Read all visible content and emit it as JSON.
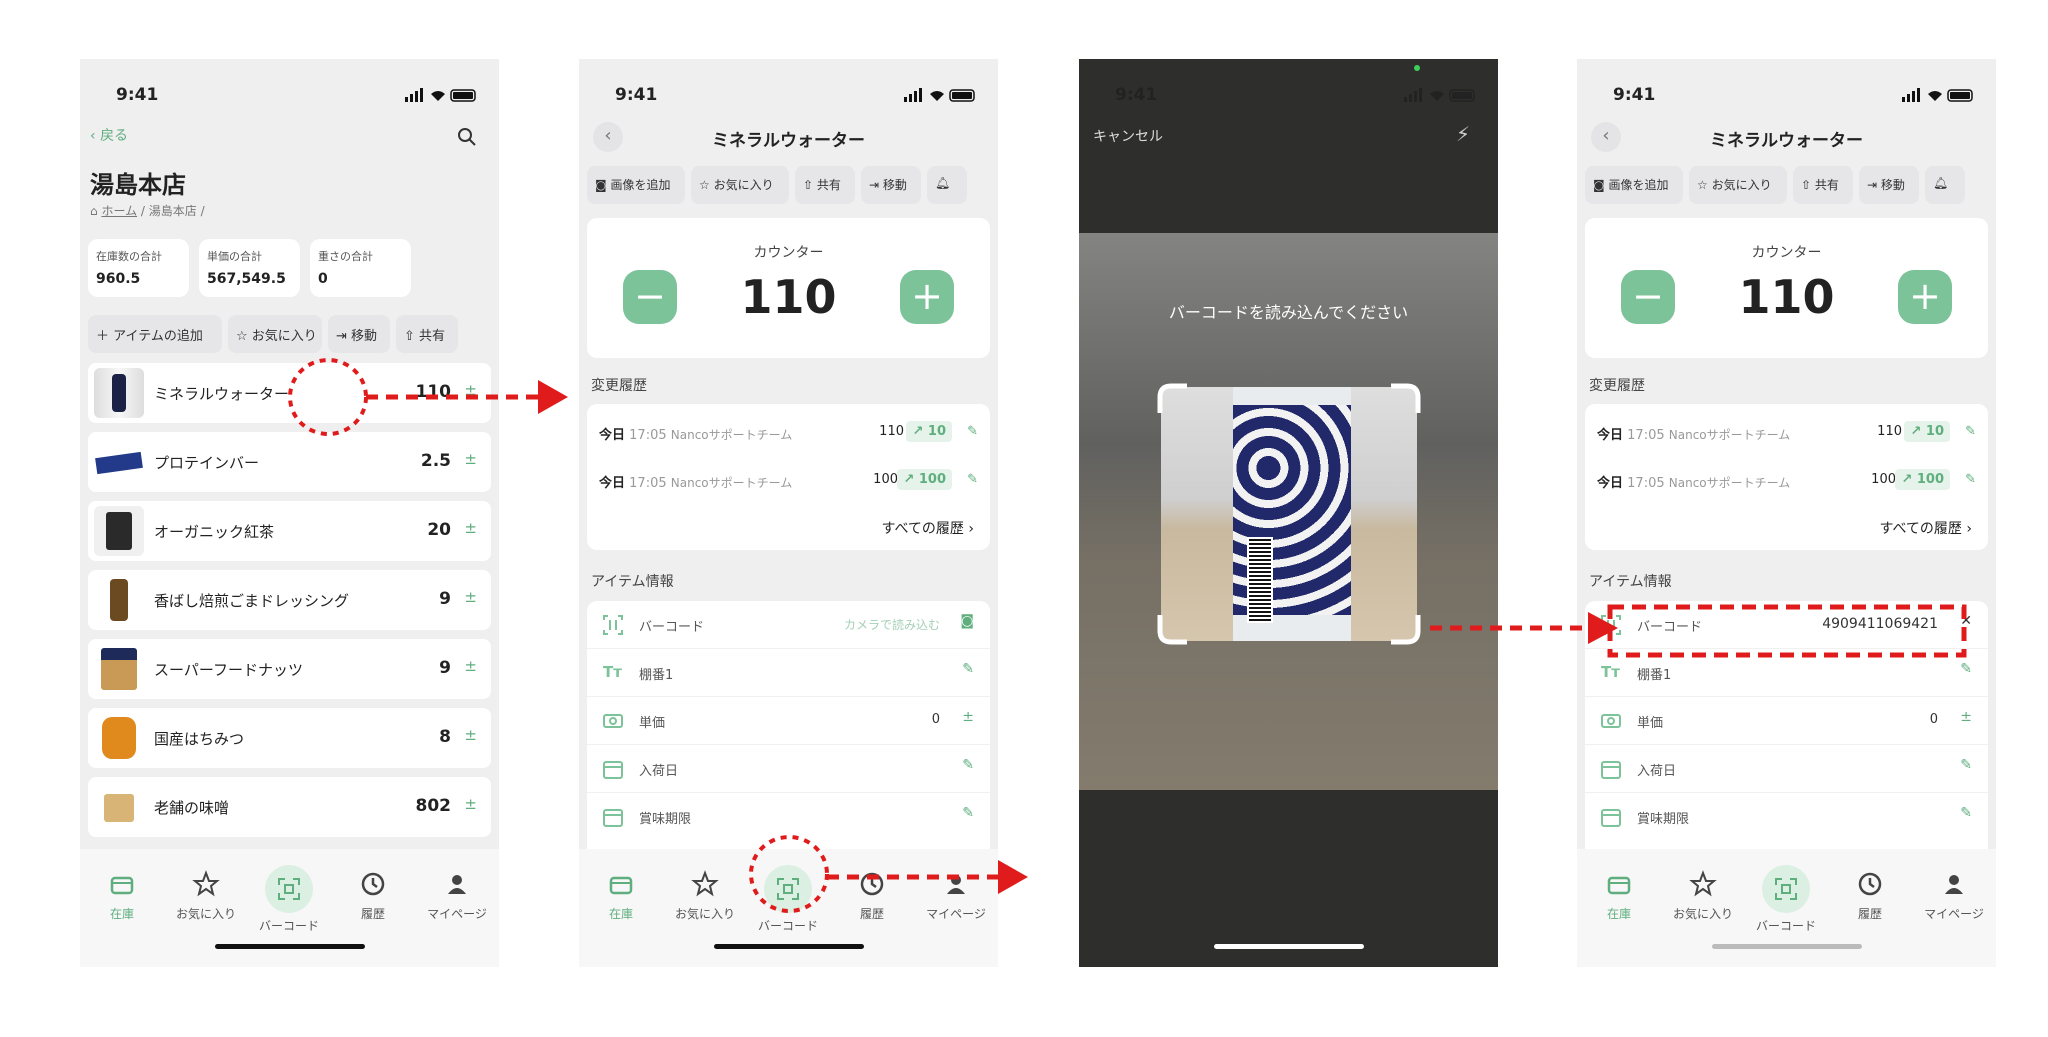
{
  "status_time": "9:41",
  "screen1": {
    "back_label": "戻る",
    "title": "湯島本店",
    "breadcrumb_home": "ホーム",
    "breadcrumb_current": "湯島本店",
    "stats": [
      {
        "label": "在庫数の合計",
        "value": "960.5"
      },
      {
        "label": "単価の合計",
        "value": "567,549.5"
      },
      {
        "label": "重さの合計",
        "value": "0"
      }
    ],
    "actions": [
      "＋ アイテムの追加",
      "お気に入り",
      "移動",
      "共有"
    ],
    "items": [
      {
        "name": "ミネラルウォーター",
        "qty": "110"
      },
      {
        "name": "プロテインバー",
        "qty": "2.5"
      },
      {
        "name": "オーガニック紅茶",
        "qty": "20"
      },
      {
        "name": "香ばし焙煎ごまドレッシング",
        "qty": "9"
      },
      {
        "name": "スーパーフードナッツ",
        "qty": "9"
      },
      {
        "name": "国産はちみつ",
        "qty": "8"
      },
      {
        "name": "老舗の味噌",
        "qty": "802"
      }
    ]
  },
  "tabs": [
    "在庫",
    "お気に入り",
    "バーコード",
    "履歴",
    "マイページ"
  ],
  "detail": {
    "title": "ミネラルウォーター",
    "actions": [
      "画像を追加",
      "お気に入り",
      "共有",
      "移動"
    ],
    "counter_label": "カウンター",
    "counter_value": "110",
    "history_heading": "変更履歴",
    "history": [
      {
        "day": "今日",
        "time": "17:05",
        "user": "Nancoサポートチーム",
        "value": "110",
        "delta": "10"
      },
      {
        "day": "今日",
        "time": "17:05",
        "user": "Nancoサポートチーム",
        "value": "100",
        "delta": "100"
      }
    ],
    "all_history": "すべての履歴",
    "info_heading": "アイテム情報",
    "fields": [
      {
        "label": "バーコード",
        "value": "カメラで読み込む"
      },
      {
        "label": "棚番1",
        "value": ""
      },
      {
        "label": "単価",
        "value": "0"
      },
      {
        "label": "入荷日",
        "value": ""
      },
      {
        "label": "賞味期限",
        "value": ""
      }
    ],
    "barcode_value": "4909411069421"
  },
  "scanner": {
    "cancel": "キャンセル",
    "prompt": "バーコードを読み込んでください"
  },
  "colors": {
    "accent": "#5fae7e",
    "arrow": "#e01b1b"
  }
}
